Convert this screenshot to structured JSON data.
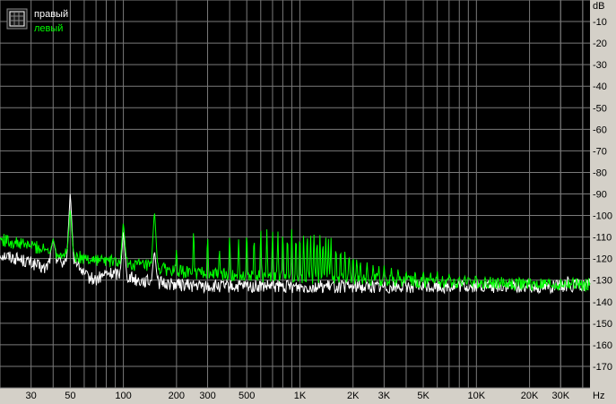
{
  "chart_data": {
    "type": "line",
    "x_scale": "log",
    "xlim": [
      20,
      44000
    ],
    "ylim": [
      -180,
      0
    ],
    "x_unit": "Hz",
    "y_unit": "dB",
    "x_tick_labels": [
      "30",
      "50",
      "100",
      "200",
      "300",
      "500",
      "1K",
      "2K",
      "3K",
      "5K",
      "10K",
      "20K",
      "30K"
    ],
    "x_tick_values": [
      30,
      50,
      100,
      200,
      300,
      500,
      1000,
      2000,
      3000,
      5000,
      10000,
      20000,
      30000
    ],
    "y_tick_values": [
      -10,
      -20,
      -30,
      -40,
      -50,
      -60,
      -70,
      -80,
      -90,
      -100,
      -110,
      -120,
      -130,
      -140,
      -150,
      -160,
      -170
    ],
    "grid": true,
    "legend_position": "top-left",
    "background_color": "#000000",
    "grid_color": "#7a7a7a",
    "series": [
      {
        "name": "правый",
        "color": "#ffffff",
        "floor": [
          [
            20,
            -118
          ],
          [
            25,
            -120
          ],
          [
            30,
            -122
          ],
          [
            36,
            -125
          ],
          [
            40,
            -118
          ],
          [
            45,
            -122
          ],
          [
            50,
            -118
          ],
          [
            55,
            -122
          ],
          [
            60,
            -128
          ],
          [
            70,
            -130
          ],
          [
            80,
            -127
          ],
          [
            100,
            -127
          ],
          [
            120,
            -130
          ],
          [
            150,
            -131
          ],
          [
            200,
            -132
          ],
          [
            300,
            -133
          ],
          [
            500,
            -133
          ],
          [
            1000,
            -133
          ],
          [
            2000,
            -133
          ],
          [
            5000,
            -133
          ],
          [
            10000,
            -133
          ],
          [
            20000,
            -133
          ],
          [
            30000,
            -133
          ],
          [
            44000,
            -132
          ]
        ],
        "peaks": [
          [
            40,
            -111
          ],
          [
            50,
            -89
          ],
          [
            100,
            -107
          ],
          [
            150,
            -116
          ],
          [
            33000,
            -127
          ]
        ]
      },
      {
        "name": "левый",
        "color": "#00ff00",
        "floor": [
          [
            20,
            -111
          ],
          [
            25,
            -113
          ],
          [
            30,
            -114
          ],
          [
            40,
            -117
          ],
          [
            45,
            -118
          ],
          [
            50,
            -118
          ],
          [
            60,
            -120
          ],
          [
            80,
            -121
          ],
          [
            100,
            -122
          ],
          [
            150,
            -124
          ],
          [
            200,
            -126
          ],
          [
            300,
            -127
          ],
          [
            500,
            -128
          ],
          [
            1000,
            -129
          ],
          [
            2000,
            -129
          ],
          [
            3000,
            -130
          ],
          [
            5000,
            -131
          ],
          [
            10000,
            -131
          ],
          [
            20000,
            -132
          ],
          [
            44000,
            -132
          ]
        ],
        "peaks": [
          [
            40,
            -111
          ],
          [
            50,
            -97
          ],
          [
            100,
            -103
          ],
          [
            150,
            -97
          ],
          [
            200,
            -114
          ],
          [
            250,
            -103
          ],
          [
            300,
            -107
          ],
          [
            350,
            -114
          ],
          [
            400,
            -106
          ],
          [
            450,
            -110
          ],
          [
            500,
            -104
          ],
          [
            550,
            -107
          ],
          [
            600,
            -103
          ],
          [
            650,
            -105
          ],
          [
            700,
            -104
          ],
          [
            750,
            -105
          ],
          [
            800,
            -104
          ],
          [
            850,
            -106
          ],
          [
            900,
            -104
          ],
          [
            950,
            -106
          ],
          [
            1000,
            -105
          ],
          [
            1050,
            -107
          ],
          [
            1100,
            -105
          ],
          [
            1150,
            -107
          ],
          [
            1200,
            -106
          ],
          [
            1250,
            -108
          ],
          [
            1300,
            -107
          ],
          [
            1350,
            -109
          ],
          [
            1400,
            -108
          ],
          [
            1450,
            -110
          ],
          [
            1500,
            -109
          ],
          [
            1600,
            -112
          ],
          [
            1700,
            -113
          ],
          [
            1800,
            -115
          ],
          [
            1900,
            -116
          ],
          [
            2000,
            -117
          ],
          [
            2100,
            -119
          ],
          [
            2200,
            -120
          ],
          [
            2400,
            -121
          ],
          [
            2600,
            -122
          ],
          [
            2800,
            -123
          ],
          [
            3000,
            -123
          ],
          [
            3300,
            -124
          ],
          [
            3600,
            -124
          ],
          [
            4000,
            -125
          ],
          [
            4500,
            -125
          ],
          [
            5000,
            -125
          ],
          [
            5500,
            -126
          ],
          [
            6000,
            -126
          ],
          [
            7000,
            -127
          ],
          [
            8000,
            -128
          ],
          [
            9000,
            -128
          ],
          [
            10000,
            -129
          ]
        ]
      }
    ]
  }
}
